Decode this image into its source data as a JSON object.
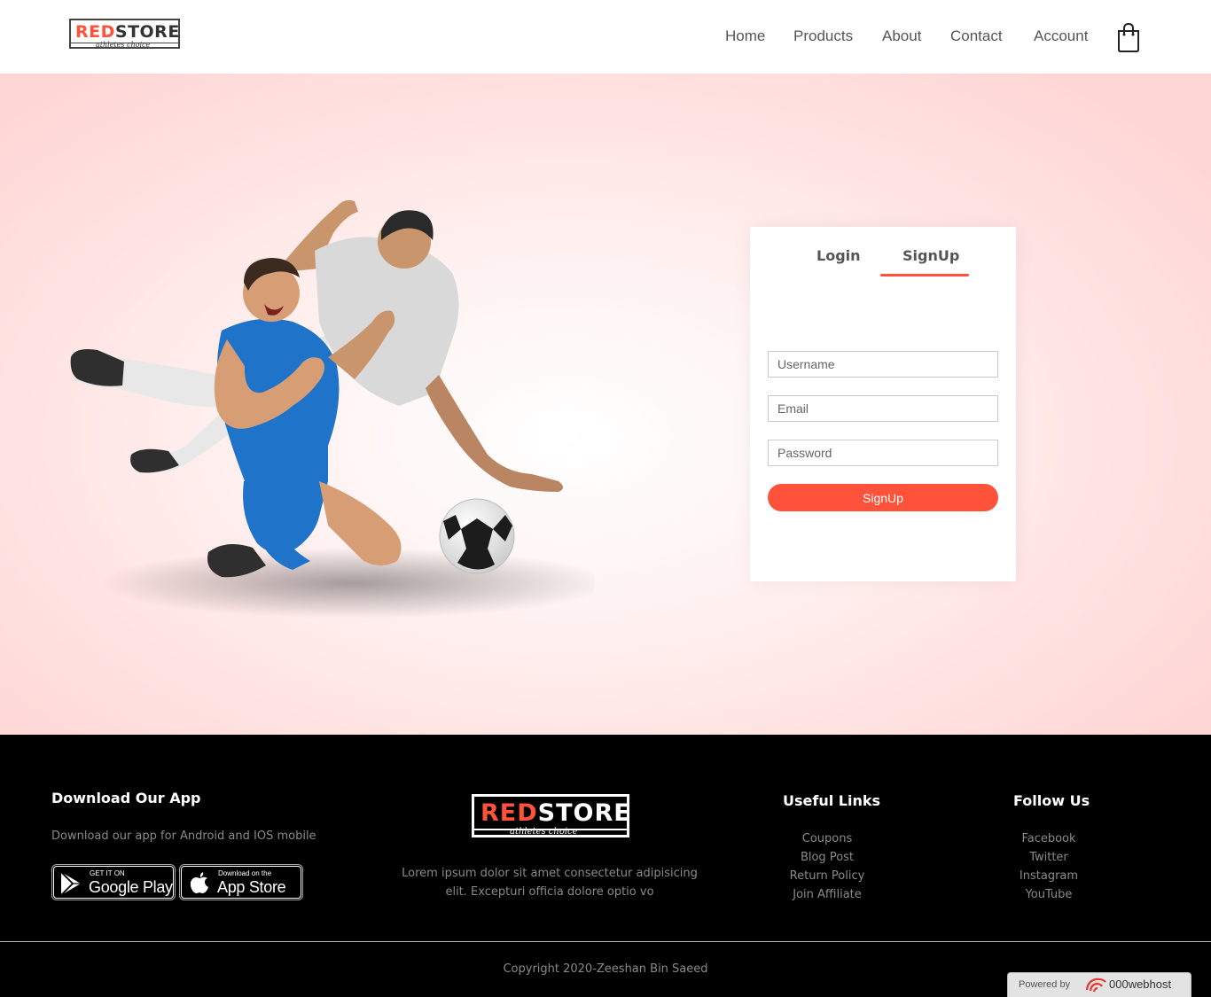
{
  "brand": {
    "logo_text_red": "RED",
    "logo_text_dark": "STORE",
    "tagline": "athletes choice"
  },
  "nav": {
    "items": [
      {
        "label": "Home"
      },
      {
        "label": "Products"
      },
      {
        "label": "About"
      },
      {
        "label": "Contact"
      },
      {
        "label": "Account"
      }
    ],
    "cart_icon": "shopping-bag-icon"
  },
  "form": {
    "tabs": {
      "login": "Login",
      "signup": "SignUp"
    },
    "active_tab": "SignUp",
    "username_placeholder": "Username",
    "email_placeholder": "Email",
    "password_placeholder": "Password",
    "submit_label": "SignUp"
  },
  "footer": {
    "app": {
      "title": "Download Our App",
      "text": "Download our app for Android and IOS mobile",
      "google_play": {
        "small": "GET IT ON",
        "big": "Google Play"
      },
      "app_store": {
        "small": "Download on the",
        "big": "App Store"
      }
    },
    "center": {
      "logo_red": "RED",
      "logo_white": "STORE",
      "tagline": "athletes choice",
      "text_line1": "Lorem ipsum dolor sit amet consectetur adipisicing",
      "text_line2": "elit. Excepturi officia dolore optio vo"
    },
    "useful_links": {
      "title": "Useful Links",
      "items": [
        "Coupons",
        "Blog Post",
        "Return Policy",
        "Join Affiliate"
      ]
    },
    "follow_us": {
      "title": "Follow Us",
      "items": [
        "Facebook",
        "Twitter",
        "Instagram",
        "YouTube"
      ]
    },
    "copyright": "Copyright 2020-Zeeshan Bin Saeed"
  },
  "badge": {
    "powered_by": "Powered by",
    "host": "000webhost"
  },
  "colors": {
    "accent": "#ff523b",
    "hero_bg": "#ffd6d6",
    "footer_bg": "#000000"
  }
}
